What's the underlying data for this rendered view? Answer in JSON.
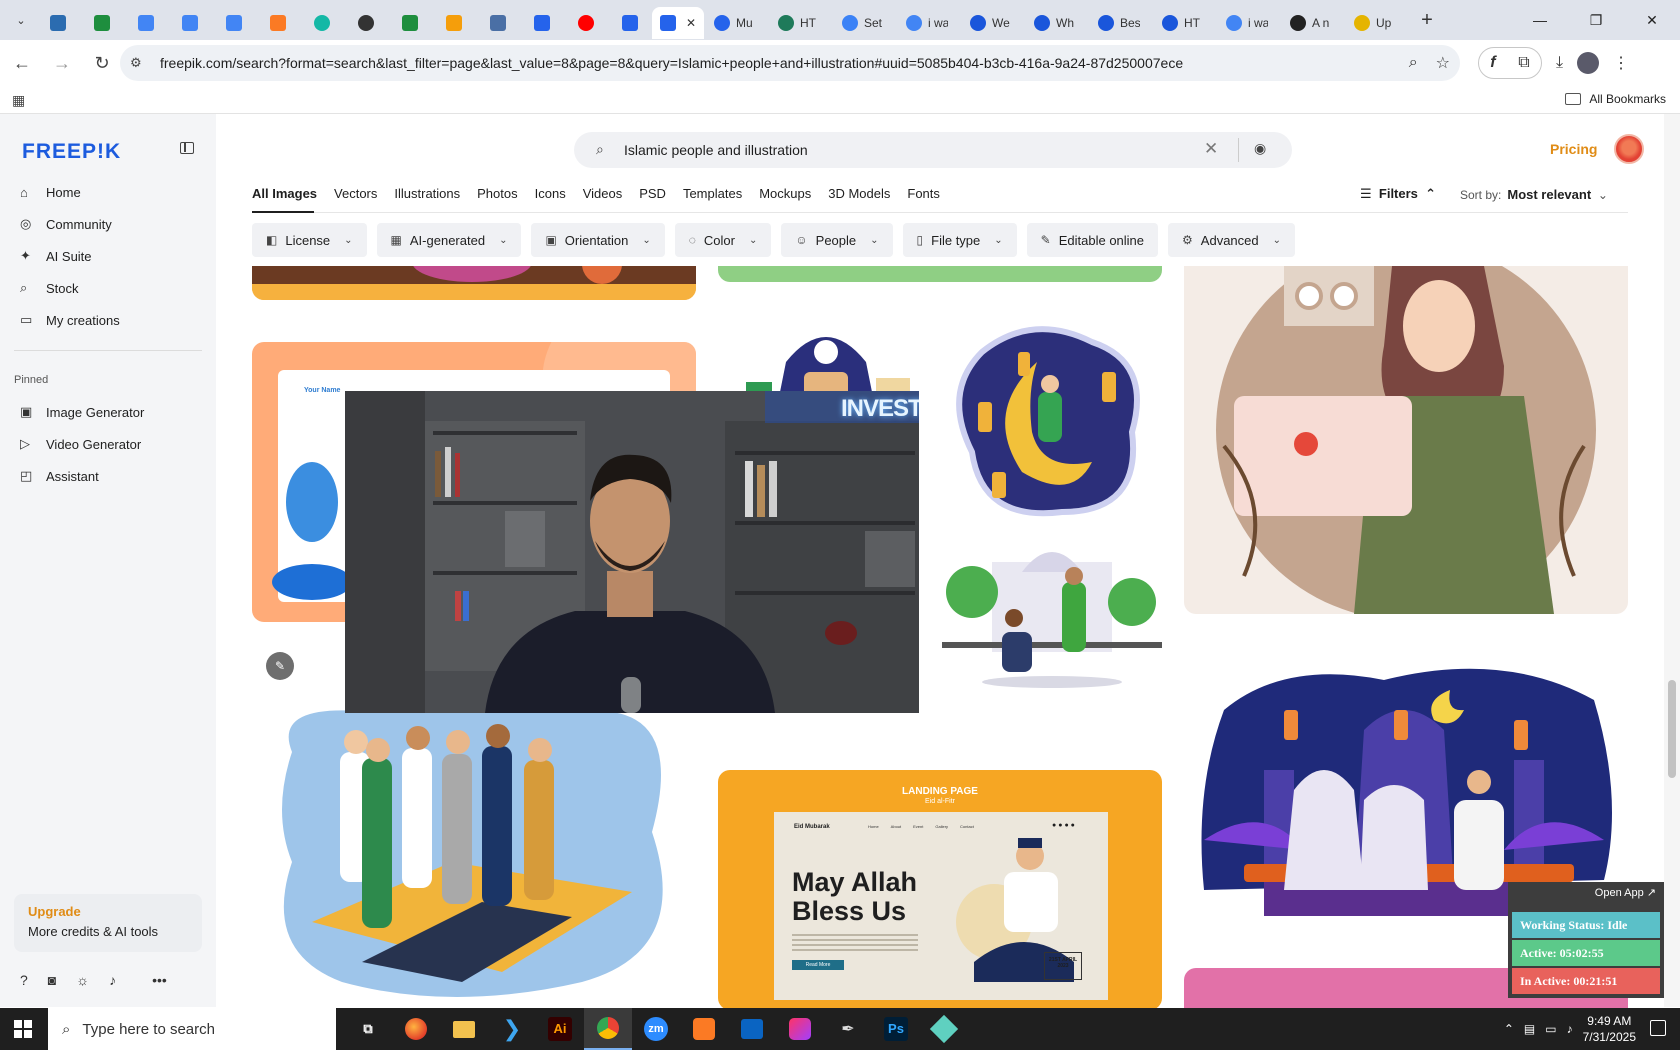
{
  "browser": {
    "tabs": [
      {
        "icon": "vpn-icon",
        "color": "#2b6cb0",
        "label": ""
      },
      {
        "icon": "sheets-icon",
        "color": "#1e8e3e",
        "label": ""
      },
      {
        "icon": "docs-icon",
        "color": "#4285f4",
        "label": ""
      },
      {
        "icon": "docs-icon",
        "color": "#4285f4",
        "label": ""
      },
      {
        "icon": "docs-icon",
        "color": "#4285f4",
        "label": ""
      },
      {
        "icon": "xampp-icon",
        "color": "#fb7a24",
        "label": ""
      },
      {
        "icon": "ext-icon",
        "color": "#14b8a6",
        "label": ""
      },
      {
        "icon": "chatgpt-icon",
        "color": "#333333",
        "label": ""
      },
      {
        "icon": "sheets-icon",
        "color": "#1e8e3e",
        "label": ""
      },
      {
        "icon": "hand-icon",
        "color": "#f59e0b",
        "label": ""
      },
      {
        "icon": "qr-icon",
        "color": "#4a6fa5",
        "label": ""
      },
      {
        "icon": "forms-icon",
        "color": "#2563eb",
        "label": ""
      },
      {
        "icon": "youtube-icon",
        "color": "#ff0000",
        "label": ""
      },
      {
        "icon": "forms-icon",
        "color": "#2563eb",
        "label": ""
      }
    ],
    "active_tab": {
      "icon": "forms-icon",
      "color": "#2563eb"
    },
    "more_tabs": [
      {
        "label": "Mu",
        "color": "#2563eb"
      },
      {
        "label": "HT",
        "color": "#1e7a5a"
      },
      {
        "label": "Set",
        "color": "#3b82f6"
      },
      {
        "label": "i wa",
        "color": "#4285f4"
      },
      {
        "label": "We",
        "color": "#1a56db"
      },
      {
        "label": "Wh",
        "color": "#1a56db"
      },
      {
        "label": "Bes",
        "color": "#1a56db"
      },
      {
        "label": "HT",
        "color": "#1a56db"
      },
      {
        "label": "i wa",
        "color": "#4285f4"
      },
      {
        "label": "A n",
        "color": "#222222"
      },
      {
        "label": "Up",
        "color": "#e5b400"
      }
    ],
    "new_tab": "+",
    "url": "freepik.com/search?format=search&last_filter=page&last_value=8&page=8&query=Islamic+people+and+illustration#uuid=5085b404-b3cb-416a-9a24-87d250007ece",
    "all_bookmarks": "All Bookmarks"
  },
  "freepik": {
    "logo": "FREEP!K",
    "nav": [
      {
        "icon": "home-icon",
        "label": "Home"
      },
      {
        "icon": "globe-icon",
        "label": "Community"
      },
      {
        "icon": "sparkle-icon",
        "label": "AI Suite"
      },
      {
        "icon": "search-icon",
        "label": "Stock"
      },
      {
        "icon": "folder-icon",
        "label": "My creations"
      }
    ],
    "pinned_label": "Pinned",
    "pinned": [
      {
        "icon": "image-icon",
        "label": "Image Generator"
      },
      {
        "icon": "video-icon",
        "label": "Video Generator"
      },
      {
        "icon": "assistant-icon",
        "label": "Assistant"
      }
    ],
    "upgrade": {
      "title": "Upgrade",
      "subtitle": "More credits & AI tools"
    },
    "search_value": "Islamic people and illustration",
    "pricing": "Pricing",
    "categories": [
      "All Images",
      "Vectors",
      "Illustrations",
      "Photos",
      "Icons",
      "Videos",
      "PSD",
      "Templates",
      "Mockups",
      "3D Models",
      "Fonts"
    ],
    "filters_label": "Filters",
    "sort_label": "Sort by:",
    "sort_value": "Most relevant",
    "chips": [
      {
        "icon": "license-icon",
        "label": "License"
      },
      {
        "icon": "ai-icon",
        "label": "AI-generated"
      },
      {
        "icon": "orientation-icon",
        "label": "Orientation"
      },
      {
        "icon": "palette-icon",
        "label": "Color"
      },
      {
        "icon": "people-icon",
        "label": "People"
      },
      {
        "icon": "file-icon",
        "label": "File type"
      },
      {
        "icon": "pencil-icon",
        "label": "Editable online"
      },
      {
        "icon": "gear-icon",
        "label": "Advanced"
      }
    ],
    "card_texts": {
      "your_name": "Your Name",
      "landing_title": "LANDING PAGE",
      "landing_sub": "Eid al-Fitr",
      "headline": "May Allah Bless Us",
      "date": "21ST APRIL 2023",
      "brand": "Eid Mubarak",
      "read_more": "Read More",
      "nav_links": [
        "Home",
        "About",
        "Event",
        "Gallery",
        "Contact"
      ]
    }
  },
  "pip": {
    "neon_text": "INVEST"
  },
  "status_widget": {
    "open_app": "Open App ↗",
    "working_status": "Working Status: Idle",
    "active": "Active: 05:02:55",
    "inactive": "In Active: 00:21:51",
    "colors": {
      "idle": "#5bc0c8",
      "active": "#5cc98a",
      "inactive": "#e8625c"
    }
  },
  "taskbar": {
    "search_placeholder": "Type here to search",
    "apps": [
      "task-view-icon",
      "firefox-icon",
      "explorer-icon",
      "vscode-icon",
      "illustrator-icon",
      "chrome-icon",
      "zoom-icon",
      "xampp-icon",
      "outlook-icon",
      "creative-cloud-icon",
      "pen-icon",
      "photoshop-icon",
      "app-icon"
    ],
    "app_labels": {
      "illustrator": "Ai",
      "zoom": "zm",
      "photoshop": "Ps"
    },
    "time": "9:49 AM",
    "date": "7/31/2025"
  }
}
